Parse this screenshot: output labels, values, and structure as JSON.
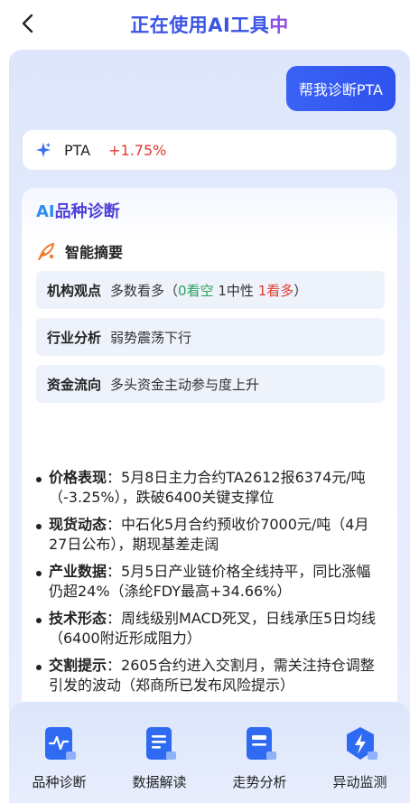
{
  "header": {
    "title_main": "正在使用AI工具",
    "title_accent": "中"
  },
  "chat": {
    "user_message": "帮我诊断PTA"
  },
  "ticker": {
    "name": "PTA",
    "change": "+1.75%",
    "change_color": "#e23b2f"
  },
  "diagnosis": {
    "title_ai": "AI",
    "title_rest": "品种诊断",
    "summary_label": "智能摘要",
    "rows": [
      {
        "key": "机构观点",
        "value_prefix": "多数看多（",
        "bearish": "0看空",
        "neutral": "1中性",
        "bullish": "1看多",
        "value_suffix": "）"
      },
      {
        "key": "行业分析",
        "value": "弱势震荡下行"
      },
      {
        "key": "资金流向",
        "value": "多头资金主动参与度上升"
      }
    ],
    "bullets": [
      {
        "key": "价格表现",
        "text": "：5月8日主力合约TA2612报6374元/吨（-3.25%），跌破6400关键支撑位"
      },
      {
        "key": "现货动态",
        "text": "：中石化5月合约预收价7000元/吨（4月27日公布），期现基差走阔"
      },
      {
        "key": "产业数据",
        "text": "：5月5日产业链价格全线持平，同比涨幅仍超24%（涤纶FDY最高+34.66%）"
      },
      {
        "key": "技术形态",
        "text": "：周线级别MACD死叉，日线承压5日均线（6400附近形成阻力）"
      },
      {
        "key": "交割提示",
        "text": "：2605合约进入交割月，需关注持仓调整引发的波动（郑商所已发布风险提示）"
      }
    ]
  },
  "toolbar": {
    "items": [
      {
        "label": "品种诊断",
        "icon": "pulse-chart-icon"
      },
      {
        "label": "数据解读",
        "icon": "document-icon"
      },
      {
        "label": "走势分析",
        "icon": "trend-doc-icon"
      },
      {
        "label": "异动监测",
        "icon": "lightning-shield-icon"
      }
    ]
  }
}
